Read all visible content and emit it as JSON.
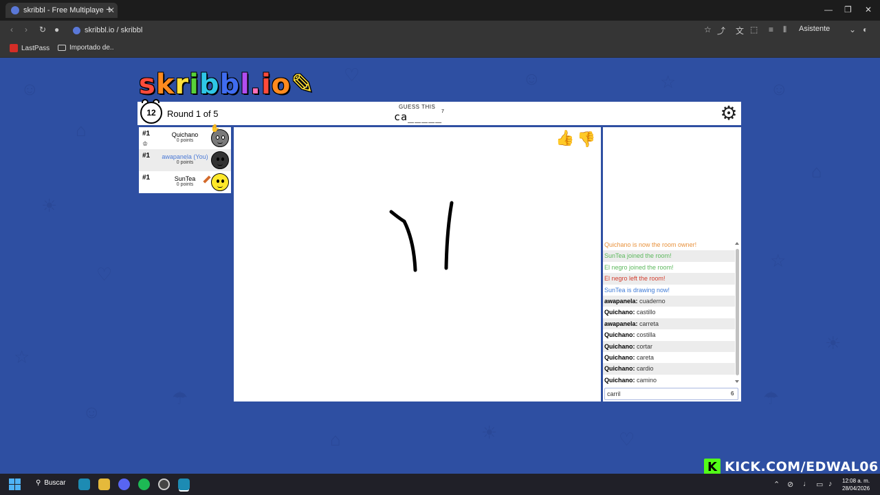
{
  "browser": {
    "tab_title": "skribbl - Free Multiplayer I",
    "url": "skribbl.io / skribbl",
    "assistant_label": "Asistente",
    "bookmarks": [
      "LastPass",
      "Importado de.."
    ]
  },
  "game": {
    "logo": "skribbl.io",
    "timer": "12",
    "round_text": "Round 1 of 5",
    "guess_label": "GUESS THIS",
    "word_hint": "ca_____",
    "word_length": "7"
  },
  "players": [
    {
      "rank": "#1",
      "name": "Quichano",
      "points": "0 points"
    },
    {
      "rank": "#1",
      "name": "awapanela (You)",
      "points": "0 points"
    },
    {
      "rank": "#1",
      "name": "SunTea",
      "points": "0 points"
    }
  ],
  "chat": {
    "messages": [
      {
        "text": "Quichano is now the room owner!",
        "color": "#e8913b"
      },
      {
        "text": "SunTea joined the room!",
        "color": "#5cb85c"
      },
      {
        "text": "El negro joined the room!",
        "color": "#5cb85c"
      },
      {
        "text": "El negro left the room!",
        "color": "#d23c2c"
      },
      {
        "text": "SunTea is drawing now!",
        "color": "#3f7bd6"
      },
      {
        "author": "awapanela:",
        "text": "cuaderno"
      },
      {
        "author": "Quichano:",
        "text": "castillo"
      },
      {
        "author": "awapanela:",
        "text": "carreta"
      },
      {
        "author": "Quichano:",
        "text": "costilla"
      },
      {
        "author": "Quichano:",
        "text": "cortar"
      },
      {
        "author": "Quichano:",
        "text": "careta"
      },
      {
        "author": "Quichano:",
        "text": "cardio"
      },
      {
        "author": "Quichano:",
        "text": "camino"
      }
    ],
    "input_value": "carril",
    "input_count": "6"
  },
  "overlay": {
    "kick_text": "KICK.COM/EDWAL06"
  },
  "taskbar": {
    "search_label": "Buscar",
    "time": "12:08 a. m.",
    "date": "28/04/2026"
  },
  "colors": {
    "page_bg": "#2e4fa2",
    "you_name": "#4a79d6",
    "kick_green": "#53fc18"
  }
}
